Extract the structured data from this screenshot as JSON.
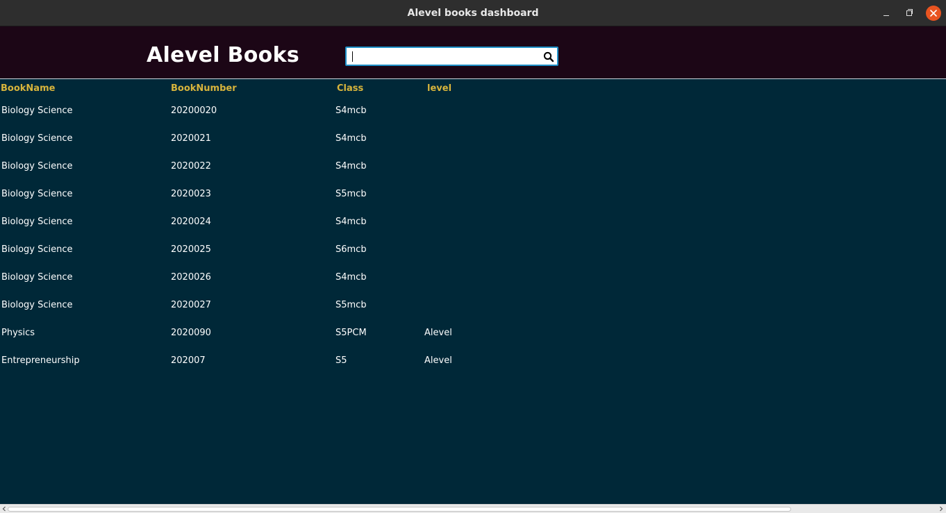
{
  "window": {
    "title": "Alevel books dashboard",
    "close_color": "#e95420"
  },
  "header": {
    "title": "Alevel Books",
    "search": {
      "value": "",
      "placeholder": "",
      "icon": "search-icon"
    }
  },
  "table": {
    "columns": [
      "BookName",
      "BookNumber",
      "Class",
      "level"
    ],
    "rows": [
      [
        "Biology Science",
        "20200020",
        "S4mcb",
        ""
      ],
      [
        "Biology Science",
        "2020021",
        "S4mcb",
        ""
      ],
      [
        "Biology Science",
        "2020022",
        "S4mcb",
        ""
      ],
      [
        "Biology Science",
        "2020023",
        "S5mcb",
        ""
      ],
      [
        "Biology Science",
        "2020024",
        "S4mcb",
        ""
      ],
      [
        "Biology Science",
        "2020025",
        "S6mcb",
        ""
      ],
      [
        "Biology Science",
        "2020026",
        "S4mcb",
        ""
      ],
      [
        "Biology Science",
        "2020027",
        "S5mcb",
        ""
      ],
      [
        "Physics",
        "2020090",
        "S5PCM",
        "Alevel"
      ],
      [
        "Entrepreneurship",
        "202007",
        "S5",
        "Alevel"
      ]
    ]
  },
  "colors": {
    "header_bg": "#1c0616",
    "body_bg": "#002838",
    "column_header_text": "#d7b43c",
    "search_border": "#1e90c8"
  }
}
